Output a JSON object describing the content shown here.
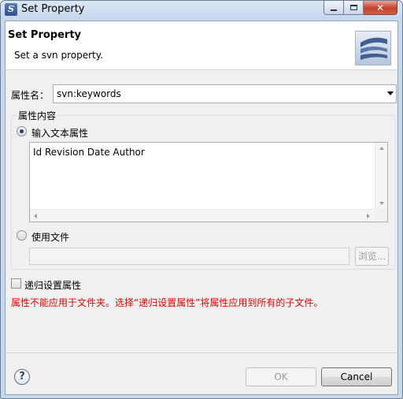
{
  "window": {
    "title": "Set Property"
  },
  "header": {
    "title": "Set Property",
    "description": "Set a svn property."
  },
  "property": {
    "label": "属性名：",
    "selected_value": "svn:keywords"
  },
  "content_group": {
    "legend": "属性内容",
    "text_option": {
      "label": "输入文本属性",
      "checked": true,
      "value": "Id Revision Date Author"
    },
    "file_option": {
      "label": "使用文件",
      "checked": false,
      "path_value": "",
      "browse_label": "浏览..."
    }
  },
  "recursive": {
    "label": "递归设置属性",
    "checked": false
  },
  "error_message": "属性不能应用于文件夹。选择“递归设置属性”将属性应用到所有的子文件。",
  "buttons": {
    "help_label": "?",
    "ok_label": "OK",
    "cancel_label": "Cancel"
  },
  "colors": {
    "error": "#e20000",
    "title_bar": "#c9d9ec",
    "close_button": "#c4412b"
  }
}
